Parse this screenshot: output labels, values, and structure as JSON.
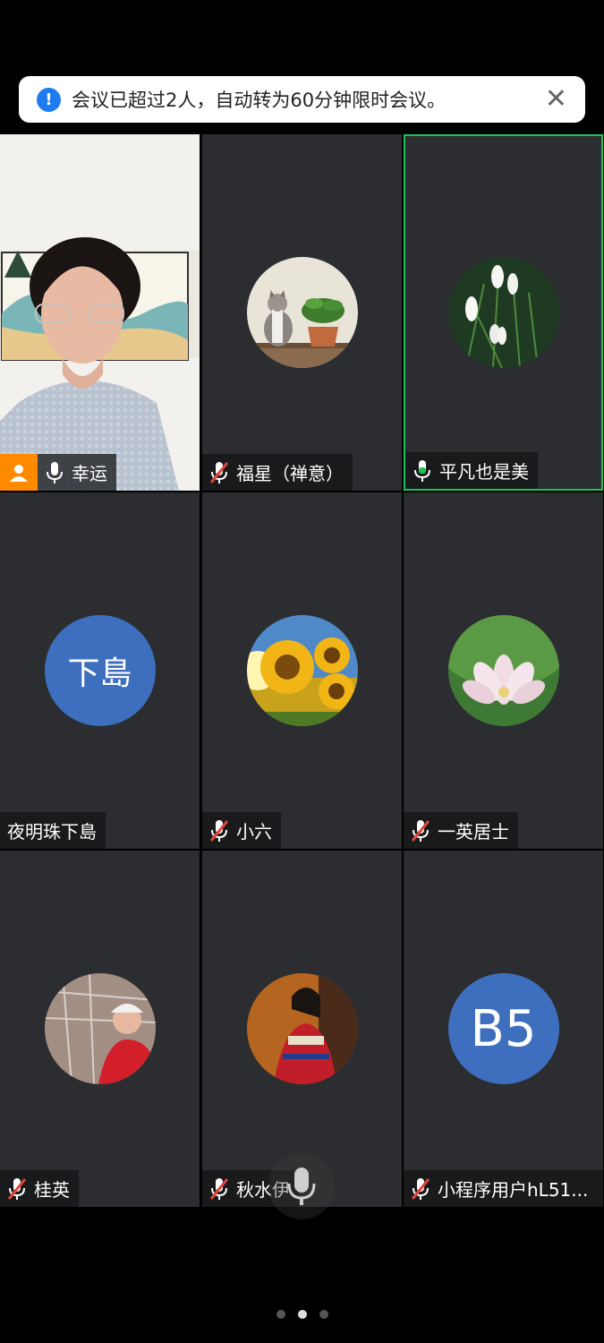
{
  "notice": {
    "text": "会议已超过2人，自动转为60分钟限时会议。",
    "info_icon": "info-icon",
    "close_icon": "close-icon",
    "accent": "#1f7cf0"
  },
  "participants": [
    {
      "name": "幸运",
      "mic": "on",
      "media": "video",
      "host": true
    },
    {
      "name": "福星（禅意）",
      "mic": "muted",
      "avatar_icon": "cat-plant-avatar"
    },
    {
      "name": "平凡也是美",
      "mic": "active",
      "avatar_icon": "white-flowers-avatar",
      "speaking": true
    },
    {
      "name": "夜明珠下島",
      "mic": "none",
      "avatar_text": "下島"
    },
    {
      "name": "小六",
      "mic": "muted",
      "avatar_icon": "sunflower-avatar"
    },
    {
      "name": "一英居士",
      "mic": "muted",
      "avatar_icon": "lotus-avatar"
    },
    {
      "name": "桂英",
      "mic": "muted",
      "avatar_icon": "woman-photo-avatar"
    },
    {
      "name": "秋水伊",
      "mic": "muted",
      "avatar_icon": "girl-photo-avatar"
    },
    {
      "name": "小程序用户hL51...",
      "mic": "muted",
      "avatar_text": "B5"
    }
  ],
  "pager": {
    "pages": 3,
    "current": 2
  },
  "colors": {
    "tile_bg": "#2b2d30",
    "speaking_border": "#1ec45b",
    "host_badge": "#ff8a00",
    "muted_red": "#e0453b",
    "letter_avatar": "#3d6fbe"
  }
}
